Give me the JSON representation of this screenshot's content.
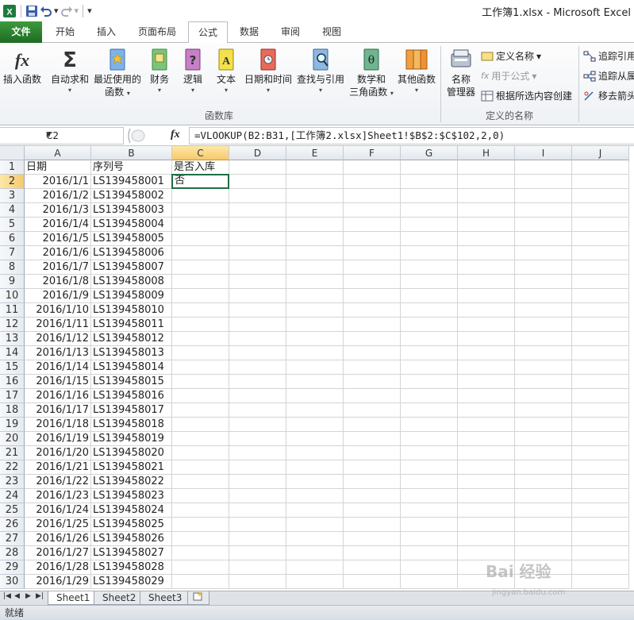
{
  "window": {
    "title": "工作簿1.xlsx - Microsoft Excel"
  },
  "tabs": [
    {
      "label": "文件"
    },
    {
      "label": "开始"
    },
    {
      "label": "插入"
    },
    {
      "label": "页面布局"
    },
    {
      "label": "公式"
    },
    {
      "label": "数据"
    },
    {
      "label": "审阅"
    },
    {
      "label": "视图"
    }
  ],
  "ribbon": {
    "function_library": {
      "group_label": "函数库",
      "insert_function": "插入函数",
      "autosum": "自动求和",
      "recent_line1": "最近使用的",
      "recent_line2": "函数",
      "financial": "财务",
      "logical": "逻辑",
      "text": "文本",
      "datetime": "日期和时间",
      "lookup": "查找与引用",
      "math_line1": "数学和",
      "math_line2": "三角函数",
      "more": "其他函数"
    },
    "defined_names": {
      "group_label": "定义的名称",
      "name_manager_line1": "名称",
      "name_manager_line2": "管理器",
      "define_name": "定义名称",
      "use_in_formula": "用于公式",
      "create_from_selection": "根据所选内容创建"
    },
    "auditing": {
      "trace_precedents": "追踪引用",
      "trace_dependents": "追踪从属",
      "remove_arrows": "移去箭头"
    }
  },
  "formula_bar": {
    "name_box": "C2",
    "fx": "fx",
    "formula": "=VLOOKUP(B2:B31,[工作簿2.xlsx]Sheet1!$B$2:$C$102,2,0)"
  },
  "columns": [
    "A",
    "B",
    "C",
    "D",
    "E",
    "F",
    "G",
    "H",
    "I",
    "J"
  ],
  "rows": [
    {
      "n": "1",
      "a": "日期",
      "b": "序列号",
      "c": "是否入库"
    },
    {
      "n": "2",
      "a": "2016/1/1",
      "b": "LS139458001",
      "c": "否"
    },
    {
      "n": "3",
      "a": "2016/1/2",
      "b": "LS139458002",
      "c": ""
    },
    {
      "n": "4",
      "a": "2016/1/3",
      "b": "LS139458003",
      "c": ""
    },
    {
      "n": "5",
      "a": "2016/1/4",
      "b": "LS139458004",
      "c": ""
    },
    {
      "n": "6",
      "a": "2016/1/5",
      "b": "LS139458005",
      "c": ""
    },
    {
      "n": "7",
      "a": "2016/1/6",
      "b": "LS139458006",
      "c": ""
    },
    {
      "n": "8",
      "a": "2016/1/7",
      "b": "LS139458007",
      "c": ""
    },
    {
      "n": "9",
      "a": "2016/1/8",
      "b": "LS139458008",
      "c": ""
    },
    {
      "n": "10",
      "a": "2016/1/9",
      "b": "LS139458009",
      "c": ""
    },
    {
      "n": "11",
      "a": "2016/1/10",
      "b": "LS139458010",
      "c": ""
    },
    {
      "n": "12",
      "a": "2016/1/11",
      "b": "LS139458011",
      "c": ""
    },
    {
      "n": "13",
      "a": "2016/1/12",
      "b": "LS139458012",
      "c": ""
    },
    {
      "n": "14",
      "a": "2016/1/13",
      "b": "LS139458013",
      "c": ""
    },
    {
      "n": "15",
      "a": "2016/1/14",
      "b": "LS139458014",
      "c": ""
    },
    {
      "n": "16",
      "a": "2016/1/15",
      "b": "LS139458015",
      "c": ""
    },
    {
      "n": "17",
      "a": "2016/1/16",
      "b": "LS139458016",
      "c": ""
    },
    {
      "n": "18",
      "a": "2016/1/17",
      "b": "LS139458017",
      "c": ""
    },
    {
      "n": "19",
      "a": "2016/1/18",
      "b": "LS139458018",
      "c": ""
    },
    {
      "n": "20",
      "a": "2016/1/19",
      "b": "LS139458019",
      "c": ""
    },
    {
      "n": "21",
      "a": "2016/1/20",
      "b": "LS139458020",
      "c": ""
    },
    {
      "n": "22",
      "a": "2016/1/21",
      "b": "LS139458021",
      "c": ""
    },
    {
      "n": "23",
      "a": "2016/1/22",
      "b": "LS139458022",
      "c": ""
    },
    {
      "n": "24",
      "a": "2016/1/23",
      "b": "LS139458023",
      "c": ""
    },
    {
      "n": "25",
      "a": "2016/1/24",
      "b": "LS139458024",
      "c": ""
    },
    {
      "n": "26",
      "a": "2016/1/25",
      "b": "LS139458025",
      "c": ""
    },
    {
      "n": "27",
      "a": "2016/1/26",
      "b": "LS139458026",
      "c": ""
    },
    {
      "n": "28",
      "a": "2016/1/27",
      "b": "LS139458027",
      "c": ""
    },
    {
      "n": "29",
      "a": "2016/1/28",
      "b": "LS139458028",
      "c": ""
    },
    {
      "n": "30",
      "a": "2016/1/29",
      "b": "LS139458029",
      "c": ""
    }
  ],
  "sheets": [
    {
      "label": "Sheet1"
    },
    {
      "label": "Sheet2"
    },
    {
      "label": "Sheet3"
    }
  ],
  "status": {
    "ready": "就绪"
  },
  "watermark": {
    "line1": "Bai 经验",
    "line2": "jingyan.baidu.com"
  },
  "colors": {
    "file_tab": "#2e7d32",
    "active_cell_border": "#1f6e43",
    "header_selected": "#f6c96c"
  }
}
